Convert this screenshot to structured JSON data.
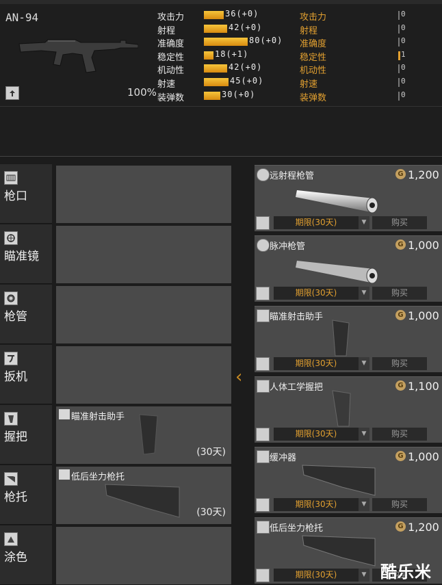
{
  "weapon": {
    "name": "AN-94",
    "durability": "100%",
    "stats": [
      {
        "label": "攻击力",
        "value": "36(+0)",
        "level": 36,
        "cmp_label": "攻击力",
        "cmp_value": "0"
      },
      {
        "label": "射程",
        "value": "42(+0)",
        "level": 42,
        "cmp_label": "射程",
        "cmp_value": "0"
      },
      {
        "label": "准确度",
        "value": "80(+0)",
        "level": 80,
        "cmp_label": "准确度",
        "cmp_value": "0"
      },
      {
        "label": "稳定性",
        "value": "18(+1)",
        "level": 18,
        "cmp_label": "稳定性",
        "cmp_value": "1"
      },
      {
        "label": "机动性",
        "value": "42(+0)",
        "level": 42,
        "cmp_label": "机动性",
        "cmp_value": "0"
      },
      {
        "label": "射速",
        "value": "45(+0)",
        "level": 45,
        "cmp_label": "射速",
        "cmp_value": "0"
      },
      {
        "label": "装弹数",
        "value": "30(+0)",
        "level": 30,
        "cmp_label": "装弹数",
        "cmp_value": "0"
      }
    ]
  },
  "categories": [
    {
      "label": "枪口",
      "icon": "muzzle-icon"
    },
    {
      "label": "瞄准镜",
      "icon": "scope-icon"
    },
    {
      "label": "枪管",
      "icon": "barrel-icon"
    },
    {
      "label": "扳机",
      "icon": "trigger-icon"
    },
    {
      "label": "握把",
      "icon": "grip-icon"
    },
    {
      "label": "枪托",
      "icon": "stock-icon"
    },
    {
      "label": "涂色",
      "icon": "paint-icon"
    }
  ],
  "equipped": {
    "grip": {
      "name": "瞄准射击助手",
      "days": "(30天)"
    },
    "stock": {
      "name": "低后坐力枪托",
      "days": "(30天)"
    }
  },
  "shop": {
    "currency_symbol": "G",
    "period_label": "期限(30天)",
    "buy_label": "购买",
    "items": [
      {
        "name": "远射程枪管",
        "price": "1,200",
        "kind": "barrel"
      },
      {
        "name": "脉冲枪管",
        "price": "1,000",
        "kind": "barrel"
      },
      {
        "name": "瞄准射击助手",
        "price": "1,000",
        "kind": "grip"
      },
      {
        "name": "人体工学握把",
        "price": "1,100",
        "kind": "grip"
      },
      {
        "name": "缓冲器",
        "price": "1,000",
        "kind": "stock"
      },
      {
        "name": "低后坐力枪托",
        "price": "1,200",
        "kind": "stock"
      }
    ]
  },
  "watermark": "酷乐米",
  "colors": {
    "accent": "#e2a030",
    "bar": "#f6c53b",
    "panel": "#4a4a4a"
  }
}
